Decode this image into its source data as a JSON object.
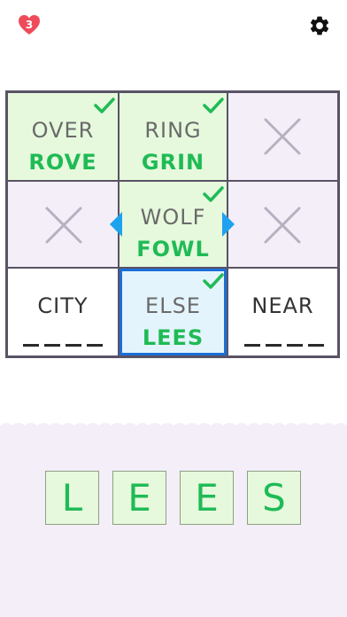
{
  "header": {
    "lives": "3",
    "lives_icon": "heart-icon",
    "settings_icon": "gear-icon"
  },
  "grid": {
    "cells": [
      {
        "word": "OVER",
        "answer": "ROVE",
        "state": "solved"
      },
      {
        "word": "RING",
        "answer": "GRIN",
        "state": "solved"
      },
      {
        "word": "",
        "answer": "",
        "state": "blocked"
      },
      {
        "word": "",
        "answer": "",
        "state": "blocked"
      },
      {
        "word": "WOLF",
        "answer": "FOWL",
        "state": "solved"
      },
      {
        "word": "",
        "answer": "",
        "state": "blocked"
      },
      {
        "word": "CITY",
        "answer": "",
        "state": "open"
      },
      {
        "word": "ELSE",
        "answer": "LEES",
        "state": "active-solved"
      },
      {
        "word": "NEAR",
        "answer": "",
        "state": "open"
      }
    ]
  },
  "tiles": [
    "L",
    "E",
    "E",
    "S"
  ],
  "colors": {
    "solved_bg": "#e6f9dd",
    "answer_green": "#1fbb55",
    "active_border": "#1b6fd6",
    "blocked_bg": "#f3eef8",
    "heart": "#f04b5a"
  }
}
